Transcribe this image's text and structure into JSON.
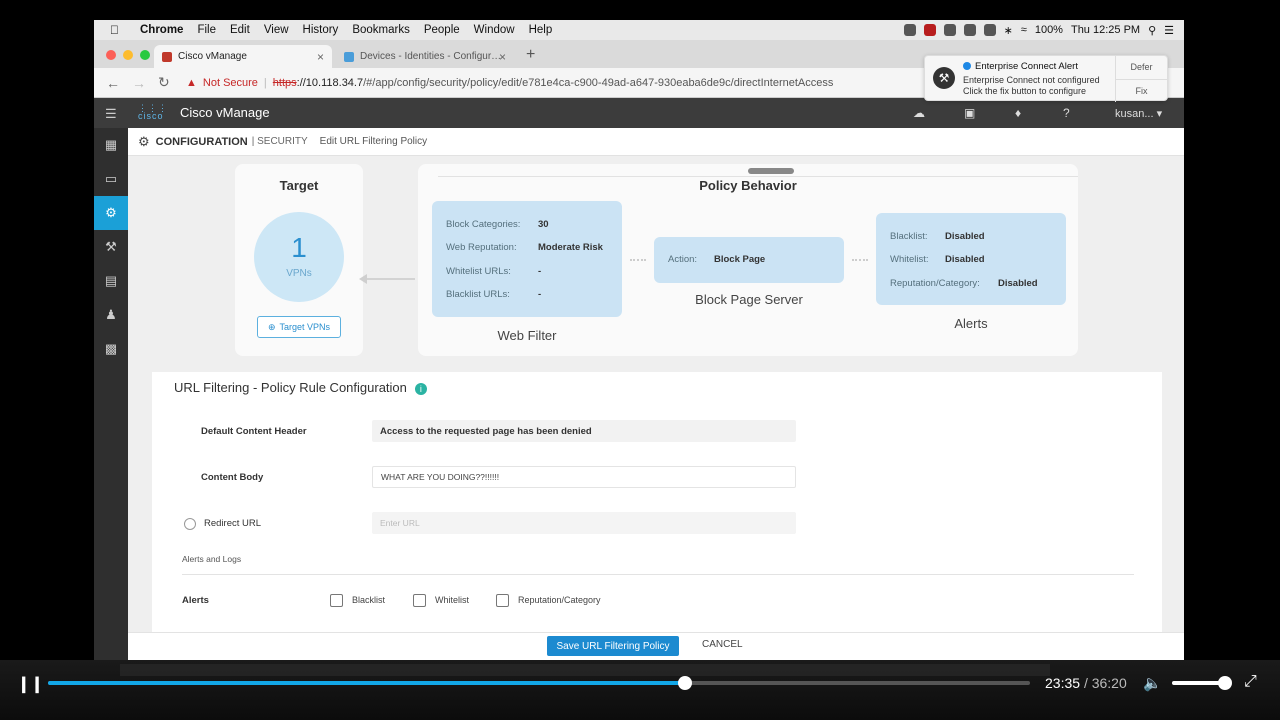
{
  "menubar": {
    "app": "Chrome",
    "items": [
      "File",
      "Edit",
      "View",
      "History",
      "Bookmarks",
      "People",
      "Window",
      "Help"
    ],
    "battery": "100%",
    "clock": "Thu 12:25 PM"
  },
  "tabs": [
    {
      "title": "Cisco vManage",
      "active": true
    },
    {
      "title": "Devices - Identities - Configur…",
      "active": false
    }
  ],
  "address": {
    "security_label": "Not Secure",
    "scheme": "https",
    "host": "://10.118.34.7",
    "path": "/#/app/config/security/policy/edit/e781e4ca-c900-49ad-a647-930eaba6de9c/directInternetAccess"
  },
  "notification": {
    "title": "Enterprise Connect Alert",
    "line1": "Enterprise Connect not configured",
    "line2": "Click the fix button to configure",
    "defer": "Defer",
    "fix": "Fix"
  },
  "app": {
    "brand": "Cisco vManage",
    "logo": "cisco",
    "user": "kusan..."
  },
  "breadcrumb": {
    "section": "CONFIGURATION",
    "sub": "| SECURITY",
    "page": "Edit URL Filtering Policy"
  },
  "target": {
    "title": "Target",
    "count": "1",
    "unit": "VPNs",
    "button": "Target VPNs"
  },
  "policy": {
    "title": "Policy Behavior",
    "web_filter": {
      "label": "Web Filter",
      "rows": [
        {
          "k": "Block Categories:",
          "v": "30"
        },
        {
          "k": "Web Reputation:",
          "v": "Moderate Risk"
        },
        {
          "k": "Whitelist URLs:",
          "v": "-"
        },
        {
          "k": "Blacklist URLs:",
          "v": "-"
        }
      ]
    },
    "block_page": {
      "label": "Block Page Server",
      "k": "Action:",
      "v": "Block Page"
    },
    "alerts": {
      "label": "Alerts",
      "rows": [
        {
          "k": "Blacklist:",
          "v": "Disabled"
        },
        {
          "k": "Whitelist:",
          "v": "Disabled"
        },
        {
          "k": "Reputation/Category:",
          "v": "Disabled"
        }
      ]
    }
  },
  "form": {
    "title": "URL Filtering - Policy Rule Configuration",
    "default_header_label": "Default Content Header",
    "default_header_value": "Access to the requested page has been denied",
    "content_body_label": "Content Body",
    "content_body_value": "WHAT ARE YOU DOING??!!!!!!",
    "redirect_label": "Redirect URL",
    "redirect_placeholder": "Enter URL",
    "alerts_logs": "Alerts and Logs",
    "alerts_label": "Alerts",
    "checks": [
      "Blacklist",
      "Whitelist",
      "Reputation/Category"
    ]
  },
  "footer": {
    "save": "Save URL Filtering Policy",
    "cancel": "CANCEL"
  },
  "player": {
    "current": "23:35",
    "duration": "/ 36:20",
    "progress": 0.649,
    "volume": 0.9
  },
  "colors": {
    "accent": "#1ba0d7",
    "card_blue": "#cbe3f4",
    "header": "#3c3c3c"
  }
}
